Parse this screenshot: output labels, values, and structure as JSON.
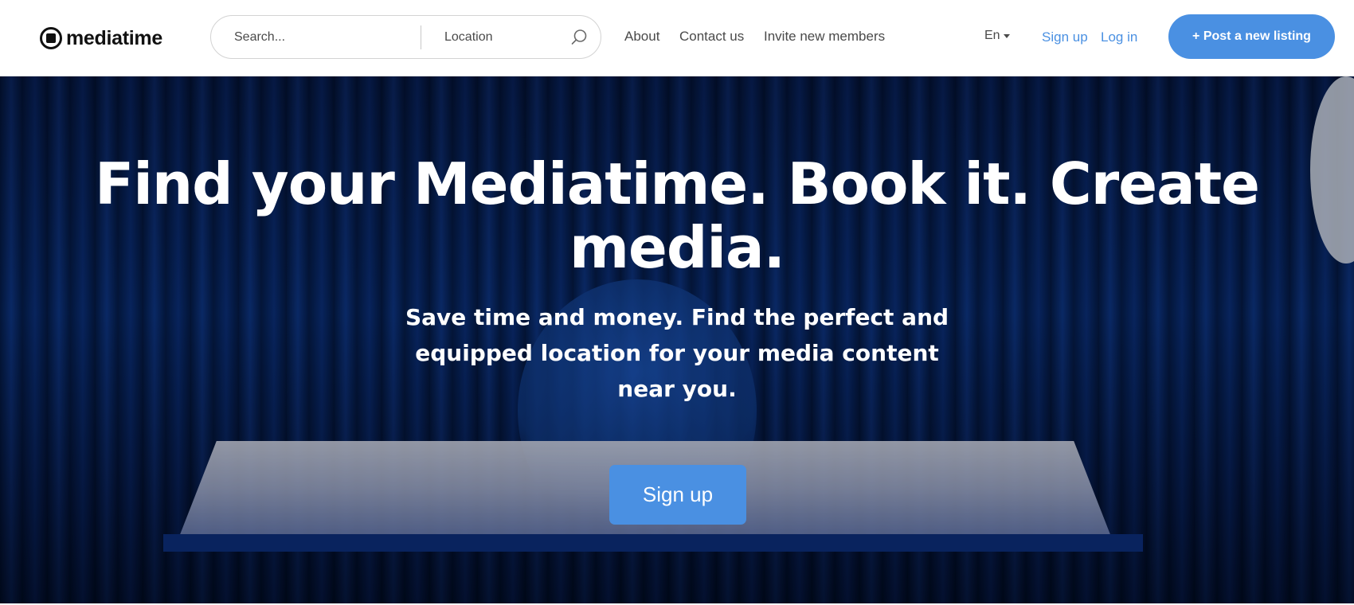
{
  "header": {
    "logo_text": "mediatime",
    "search": {
      "placeholder": "Search...",
      "location_placeholder": "Location"
    },
    "nav": {
      "about": "About",
      "contact": "Contact us",
      "invite": "Invite new members"
    },
    "language": "En",
    "sign_up": "Sign up",
    "log_in": "Log in",
    "post_listing": "+ Post a new listing"
  },
  "hero": {
    "title": "Find your Mediatime. Book it. Create media.",
    "subtitle": "Save time and money. Find the perfect and equipped location for your media content near you.",
    "cta": "Sign up"
  },
  "colors": {
    "accent": "#4a90e2",
    "text_dark": "#4a4a4a",
    "hero_bg": "#0a2d6c"
  },
  "icons": {
    "search": "search-icon",
    "language_dropdown": "chevron-down-icon",
    "logo": "logo-icon"
  }
}
